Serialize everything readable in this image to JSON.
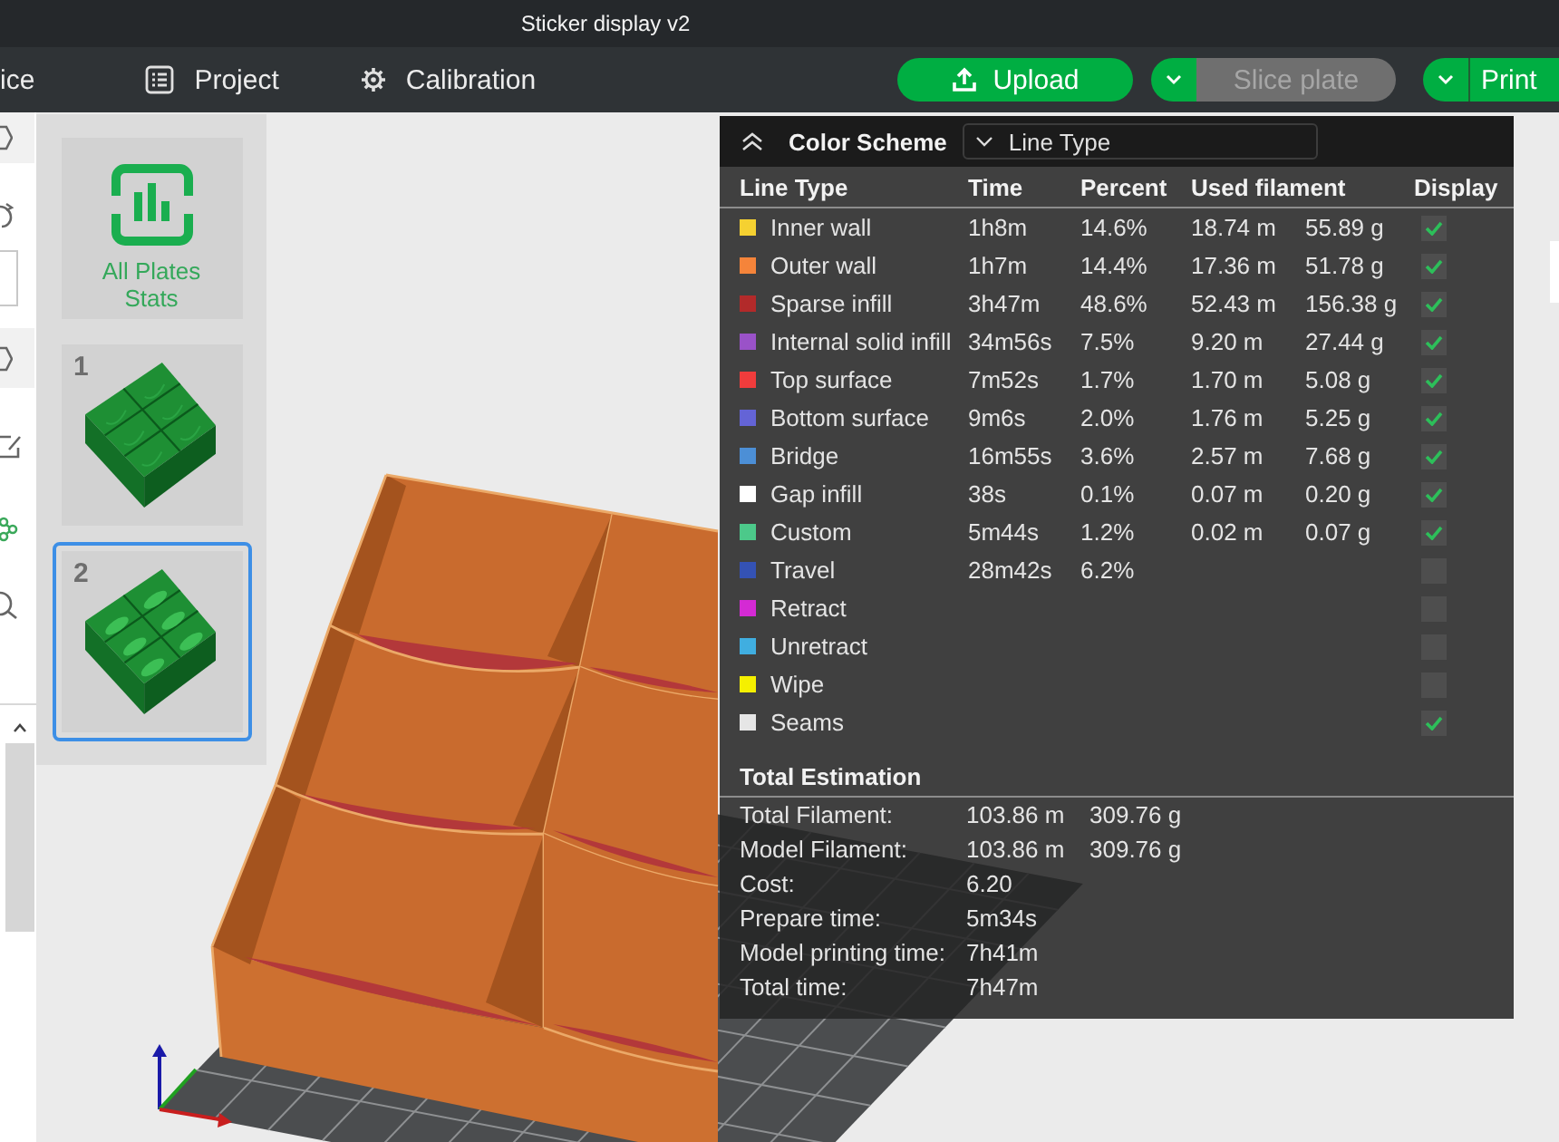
{
  "window": {
    "title": "Sticker display v2"
  },
  "toolbar": {
    "tabs": [
      {
        "label": "ice"
      },
      {
        "label": "Project"
      },
      {
        "label": "Calibration"
      }
    ],
    "upload_button": {
      "label": "Upload"
    },
    "slice_button": {
      "label": "Slice plate",
      "disabled": true
    },
    "print_button": {
      "label": "Print",
      "disabled": false
    }
  },
  "plate_list": {
    "stats_tile": {
      "label": "All Plates Stats"
    },
    "plates": [
      {
        "number": "1",
        "selected": false
      },
      {
        "number": "2",
        "selected": true
      }
    ]
  },
  "color_scheme": {
    "title": "Color Scheme",
    "expanded": true,
    "scheme": "Line Type",
    "columns": [
      "Line Type",
      "Time",
      "Percent",
      "Used filament",
      "Display"
    ],
    "rows": [
      {
        "name": "Inner wall",
        "color": "#f5d131",
        "time": "1h8m",
        "percent": "14.6%",
        "length": "18.74 m",
        "weight": "55.89 g",
        "checked": true
      },
      {
        "name": "Outer wall",
        "color": "#f5843a",
        "time": "1h7m",
        "percent": "14.4%",
        "length": "17.36 m",
        "weight": "51.78 g",
        "checked": true
      },
      {
        "name": "Sparse infill",
        "color": "#b22a2a",
        "time": "3h47m",
        "percent": "48.6%",
        "length": "52.43 m",
        "weight": "156.38 g",
        "checked": true
      },
      {
        "name": "Internal solid infill",
        "color": "#9a52c8",
        "time": "34m56s",
        "percent": "7.5%",
        "length": "9.20 m",
        "weight": "27.44 g",
        "checked": true
      },
      {
        "name": "Top surface",
        "color": "#f03c3c",
        "time": "7m52s",
        "percent": "1.7%",
        "length": "1.70 m",
        "weight": "5.08 g",
        "checked": true
      },
      {
        "name": "Bottom surface",
        "color": "#6464d6",
        "time": "9m6s",
        "percent": "2.0%",
        "length": "1.76 m",
        "weight": "5.25 g",
        "checked": true
      },
      {
        "name": "Bridge",
        "color": "#4c8fd6",
        "time": "16m55s",
        "percent": "3.6%",
        "length": "2.57 m",
        "weight": "7.68 g",
        "checked": true
      },
      {
        "name": "Gap infill",
        "color": "#ffffff",
        "time": "38s",
        "percent": "0.1%",
        "length": "0.07 m",
        "weight": "0.20 g",
        "checked": true
      },
      {
        "name": "Custom",
        "color": "#4cc98a",
        "time": "5m44s",
        "percent": "1.2%",
        "length": "0.02 m",
        "weight": "0.07 g",
        "checked": true
      },
      {
        "name": "Travel",
        "color": "#3452b4",
        "time": "28m42s",
        "percent": "6.2%",
        "checked": false
      },
      {
        "name": "Retract",
        "color": "#d42ad4",
        "checked": false
      },
      {
        "name": "Unretract",
        "color": "#40aee0",
        "checked": false
      },
      {
        "name": "Wipe",
        "color": "#f5f000",
        "checked": false
      },
      {
        "name": "Seams",
        "color": "#e6e6e6",
        "checked": true
      }
    ],
    "totals": {
      "title": "Total Estimation",
      "rows": [
        {
          "label": "Total Filament:",
          "values": [
            "103.86 m",
            "309.76 g"
          ]
        },
        {
          "label": "Model Filament:",
          "values": [
            "103.86 m",
            "309.76 g"
          ]
        },
        {
          "label": "Cost:",
          "values": [
            "6.20"
          ]
        },
        {
          "label": "Prepare time:",
          "values": [
            "5m34s"
          ]
        },
        {
          "label": "Model printing time:",
          "values": [
            "7h41m"
          ]
        },
        {
          "label": "Total time:",
          "values": [
            "7h47m"
          ]
        }
      ]
    }
  }
}
